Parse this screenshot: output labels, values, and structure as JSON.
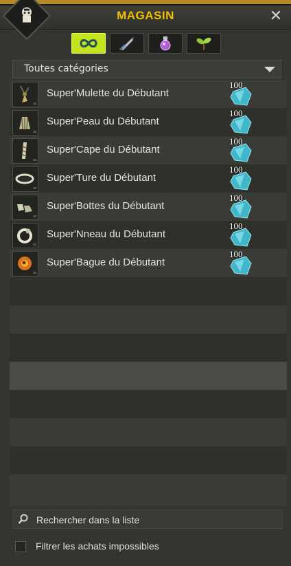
{
  "window": {
    "title": "MAGASIN",
    "close_label": "✕"
  },
  "tabs": [
    {
      "name": "all",
      "icon": "infinity-icon"
    },
    {
      "name": "equipment",
      "icon": "sword-icon"
    },
    {
      "name": "consumables",
      "icon": "potion-icon"
    },
    {
      "name": "resources",
      "icon": "sprout-icon"
    }
  ],
  "category": {
    "selected": "Toutes catégories"
  },
  "items": [
    {
      "name": "Super'Mulette du Débutant",
      "price": "100",
      "icon": "amulet-icon"
    },
    {
      "name": "Super'Peau du Débutant",
      "price": "100",
      "icon": "hat-icon"
    },
    {
      "name": "Super'Cape du Débutant",
      "price": "100",
      "icon": "cape-icon"
    },
    {
      "name": "Super'Ture du Débutant",
      "price": "100",
      "icon": "belt-icon"
    },
    {
      "name": "Super'Bottes du Débutant",
      "price": "100",
      "icon": "boots-icon"
    },
    {
      "name": "Super'Nneau du Débutant",
      "price": "100",
      "icon": "ring-icon"
    },
    {
      "name": "Super'Bague du Débutant",
      "price": "100",
      "icon": "ring-gold-icon"
    }
  ],
  "search": {
    "placeholder": "Rechercher dans la liste"
  },
  "filter": {
    "label": "Filtrer les achats impossibles",
    "checked": false
  },
  "colors": {
    "title": "#f0c000",
    "active_tab": "#c5e31d",
    "crystal": "#3fb6c9"
  }
}
